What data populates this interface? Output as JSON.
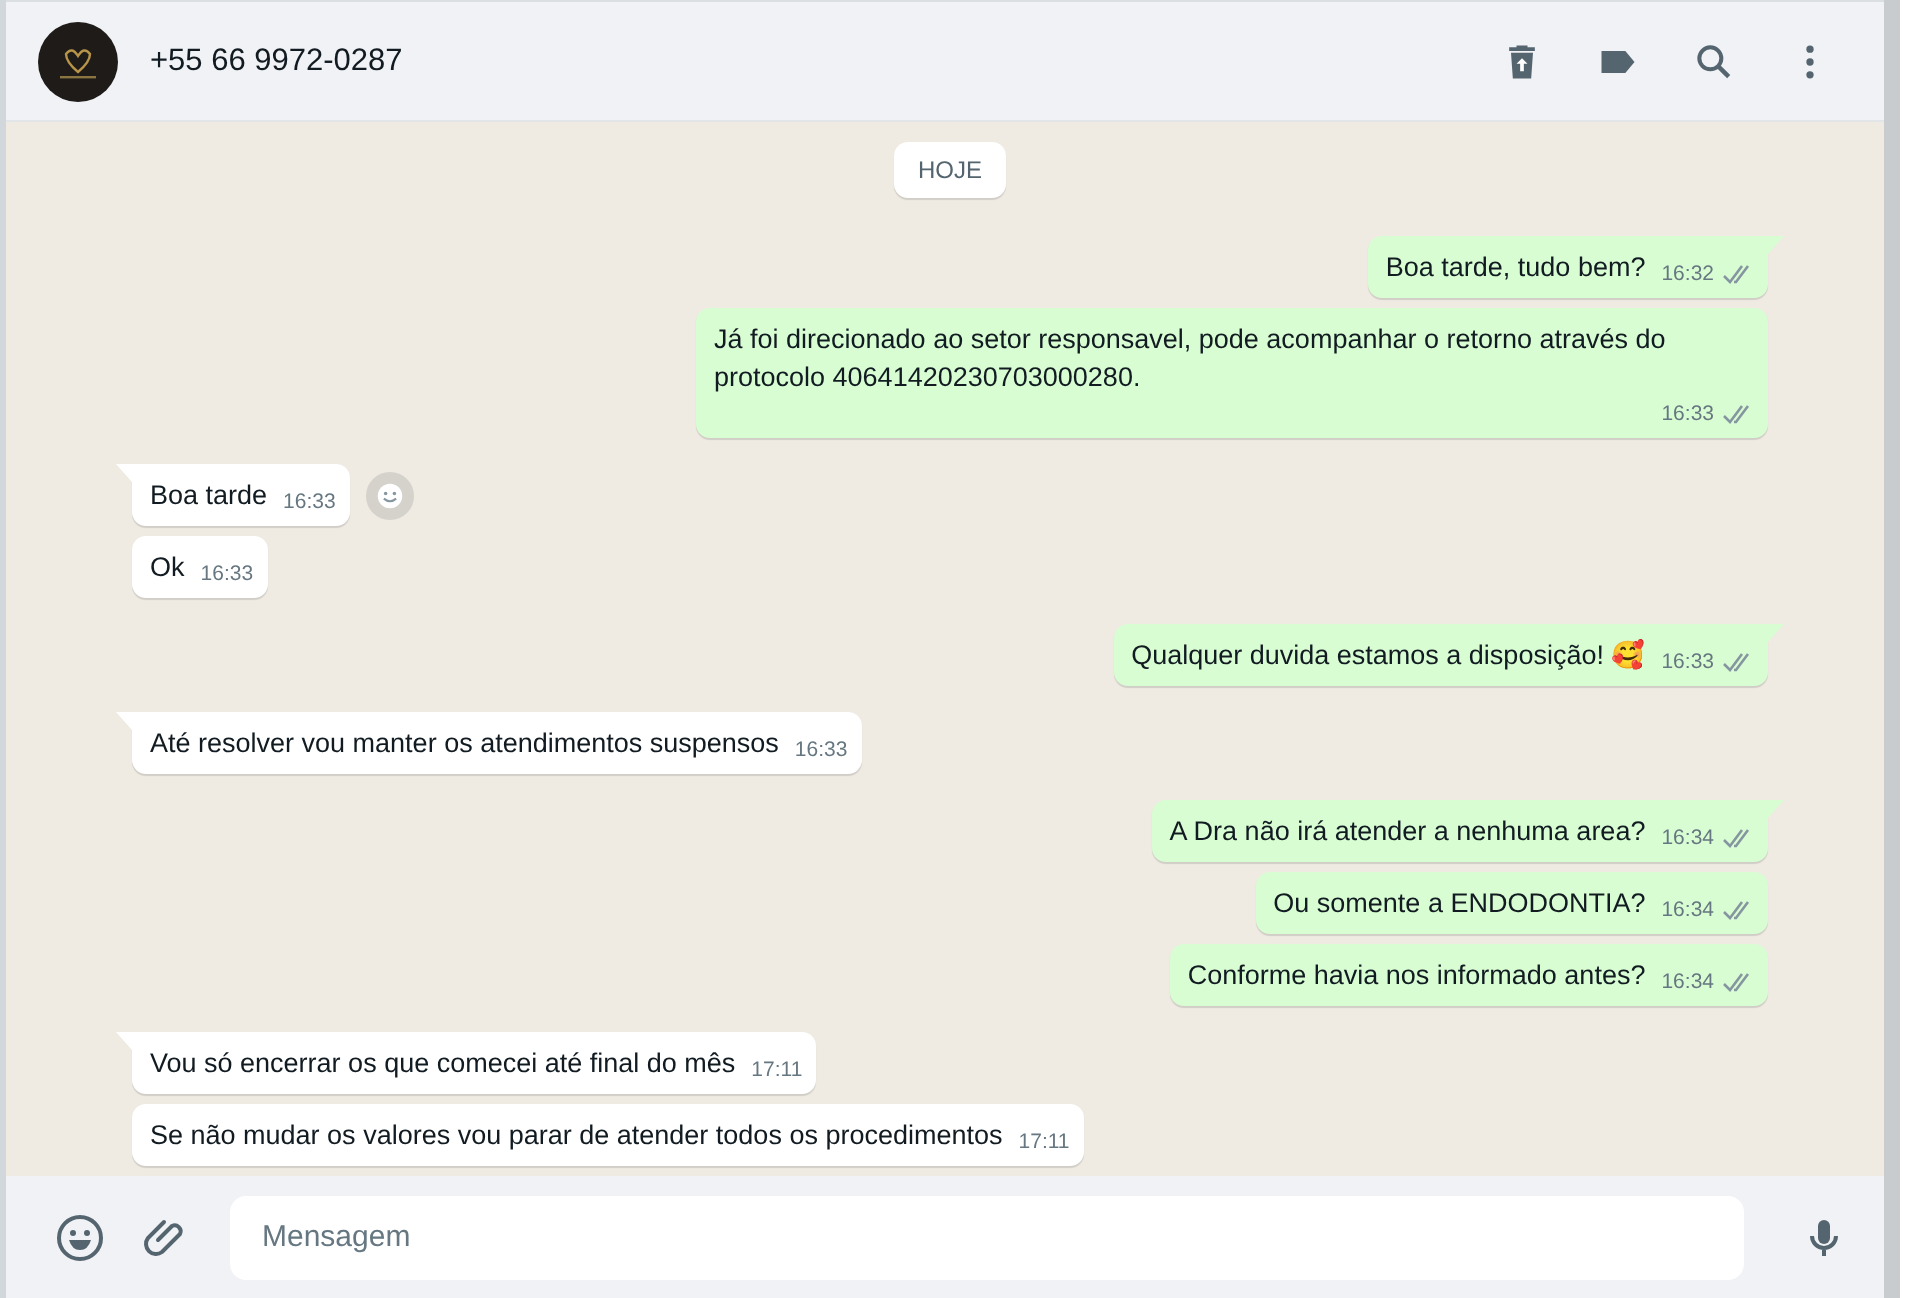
{
  "header": {
    "contact": "+55 66 9972-0287"
  },
  "date_chip": "HOJE",
  "messages": [
    {
      "kind": "outgoing",
      "text": "Boa tarde, tudo bem?",
      "time": "16:32",
      "tail": true,
      "reaction_button": false
    },
    {
      "kind": "outgoing",
      "text": "Já foi direcionado ao setor responsavel, pode acompanhar o retorno através do protocolo 40641420230703000280.",
      "time": "16:33",
      "tail": false,
      "reaction_button": false
    },
    {
      "kind": "incoming",
      "text": "Boa tarde",
      "time": "16:33",
      "tail": true,
      "reaction_button": true
    },
    {
      "kind": "incoming",
      "text": "Ok",
      "time": "16:33",
      "tail": false,
      "reaction_button": false
    },
    {
      "kind": "outgoing",
      "text": "Qualquer duvida estamos a disposição! 🥰",
      "time": "16:33",
      "tail": true,
      "reaction_button": false
    },
    {
      "kind": "incoming",
      "text": "Até resolver vou manter os atendimentos suspensos",
      "time": "16:33",
      "tail": true,
      "reaction_button": false
    },
    {
      "kind": "outgoing",
      "text": "A Dra não irá atender a nenhuma area?",
      "time": "16:34",
      "tail": true,
      "reaction_button": false
    },
    {
      "kind": "outgoing",
      "text": "Ou somente a ENDODONTIA?",
      "time": "16:34",
      "tail": false,
      "reaction_button": false
    },
    {
      "kind": "outgoing",
      "text": "Conforme havia nos informado antes?",
      "time": "16:34",
      "tail": false,
      "reaction_button": false
    },
    {
      "kind": "incoming",
      "text": "Vou só encerrar os que comecei até final do mês",
      "time": "17:11",
      "tail": true,
      "reaction_button": false
    },
    {
      "kind": "incoming",
      "text": "Se não mudar os valores vou parar de atender todos os procedimentos",
      "time": "17:11",
      "tail": false,
      "reaction_button": false
    }
  ],
  "composer": {
    "placeholder": "Mensagem"
  }
}
